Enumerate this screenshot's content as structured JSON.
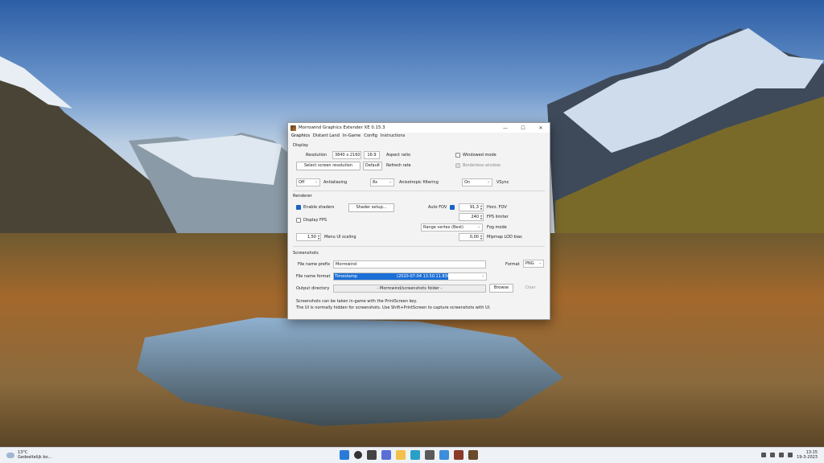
{
  "window": {
    "title": "Morrowind Graphics Extender XE 0.15.3",
    "controls": {
      "minimize": "—",
      "maximize": "☐",
      "close": "✕"
    }
  },
  "menu": [
    "Graphics",
    "Distant Land",
    "In-Game",
    "Config",
    "Instructions"
  ],
  "display": {
    "heading": "Display",
    "resolution_label": "Resolution",
    "resolution_value": "3840 x 2160",
    "aspect_value": "16:9",
    "aspect_label": "Aspect ratio",
    "windowed_mode": "Windowed mode",
    "select_resolution_button": "Select screen resolution",
    "default_button": "Default",
    "refresh_rate_label": "Refresh rate",
    "borderless_window": "Borderless window",
    "antialiasing_value": "Off",
    "antialiasing_label": "Antialiasing",
    "anisotropic_value": "8x",
    "anisotropic_label": "Anisotropic filtering",
    "vsync_value": "On",
    "vsync_label": "VSync"
  },
  "renderer": {
    "heading": "Renderer",
    "enable_shaders": "Enable shaders",
    "shader_setup_button": "Shader setup...",
    "auto_fov": "Auto FOV",
    "horz_fov_value": "91,3",
    "horz_fov_label": "Horz. FOV",
    "display_fps": "Display FPS",
    "fps_limiter_value": "240",
    "fps_limiter_label": "FPS limiter",
    "fog_mode_value": "Range vertex (Best)",
    "fog_mode_label": "Fog mode",
    "menu_ui_scaling_value": "1,50",
    "menu_ui_scaling_label": "Menu UI scaling",
    "mipmap_lod_value": "0,00",
    "mipmap_lod_label": "Mipmap LOD bias"
  },
  "screenshots": {
    "heading": "Screenshots",
    "prefix_label": "File name prefix",
    "prefix_value": "Morrowind",
    "format_label": "Format",
    "format_value": "PNG",
    "name_format_label": "File name format",
    "name_format_value": "Timestamp",
    "name_format_preview": "(2020-07-04 13.50.11.836)",
    "output_dir_label": "Output directory",
    "output_dir_value": "- Morrowind/screenshots folder -",
    "browse_button": "Browse",
    "clear_button": "Clear",
    "info_line1": "Screenshots can be taken in-game with the PrintScreen key.",
    "info_line2": "The UI is normally hidden for screenshots. Use Shift+PrintScreen to capture screenshots with UI."
  },
  "taskbar": {
    "weather_temp": "13°C",
    "weather_desc": "Gedeeltelijk bo...",
    "time": "13:15",
    "date": "19-3-2023"
  },
  "colors": {
    "accent": "#1a63c6",
    "highlight": "#1b6fd6"
  }
}
